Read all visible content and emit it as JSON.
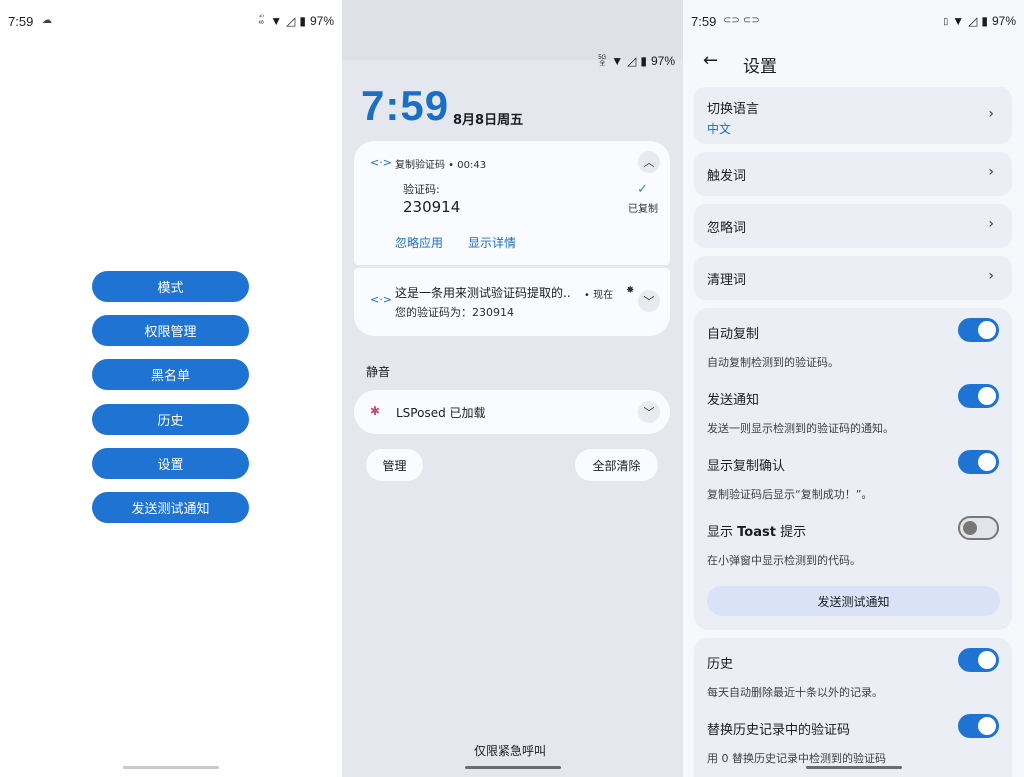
{
  "panel1": {
    "status": {
      "time": "7:59",
      "battery": "97%"
    },
    "buttons": [
      "模式",
      "权限管理",
      "黑名单",
      "历史",
      "设置",
      "发送测试通知"
    ]
  },
  "panel2": {
    "status": {
      "battery": "97%",
      "network_top": "5G",
      "network_bottom": "全"
    },
    "clock": {
      "time": "7:59",
      "date": "8月8日周五"
    },
    "notif1": {
      "app_title": "复制验证码 • 00:43",
      "label": "验证码:",
      "code": "230914",
      "copied": "已复制",
      "action_ignore": "忽略应用",
      "action_details": "显示详情"
    },
    "notif2": {
      "title": "这是一条用来测试验证码提取的..",
      "time_suffix": "• 现在",
      "body": "您的验证码为：230914"
    },
    "silent_label": "静音",
    "notif3": {
      "title": "LSPosed 已加载"
    },
    "manage_btn": "管理",
    "clear_btn": "全部清除",
    "emergency": "仅限紧急呼叫"
  },
  "panel3": {
    "status": {
      "time": "7:59",
      "battery": "97%"
    },
    "header_title": "设置",
    "language": {
      "title": "切换语言",
      "value": "中文"
    },
    "trigger_words": "触发词",
    "ignore_words": "忽略词",
    "clean_words": "清理词",
    "auto_copy": {
      "title": "自动复制",
      "sub": "自动复制检测到的验证码。",
      "on": true
    },
    "send_notif": {
      "title": "发送通知",
      "sub": "发送一则显示检测到的验证码的通知。",
      "on": true
    },
    "show_copy_confirm": {
      "title": "显示复制确认",
      "sub": "复制验证码后显示“复制成功！”。",
      "on": true
    },
    "show_toast": {
      "title_prefix": "显示",
      "title_bold": "Toast",
      "title_suffix": "提示",
      "sub": "在小弹窗中显示检测到的代码。",
      "on": false
    },
    "test_btn": "发送测试通知",
    "history": {
      "title": "历史",
      "sub": "每天自动删除最近十条以外的记录。",
      "on": true
    },
    "replace_code": {
      "title": "替换历史记录中的验证码",
      "sub": "用 0 替换历史记录中检测到的验证码",
      "on": true
    }
  },
  "colors": {
    "accent": "#1e73d3",
    "toggle_on": "#1e73d3",
    "card_bg": "#eceef5"
  }
}
